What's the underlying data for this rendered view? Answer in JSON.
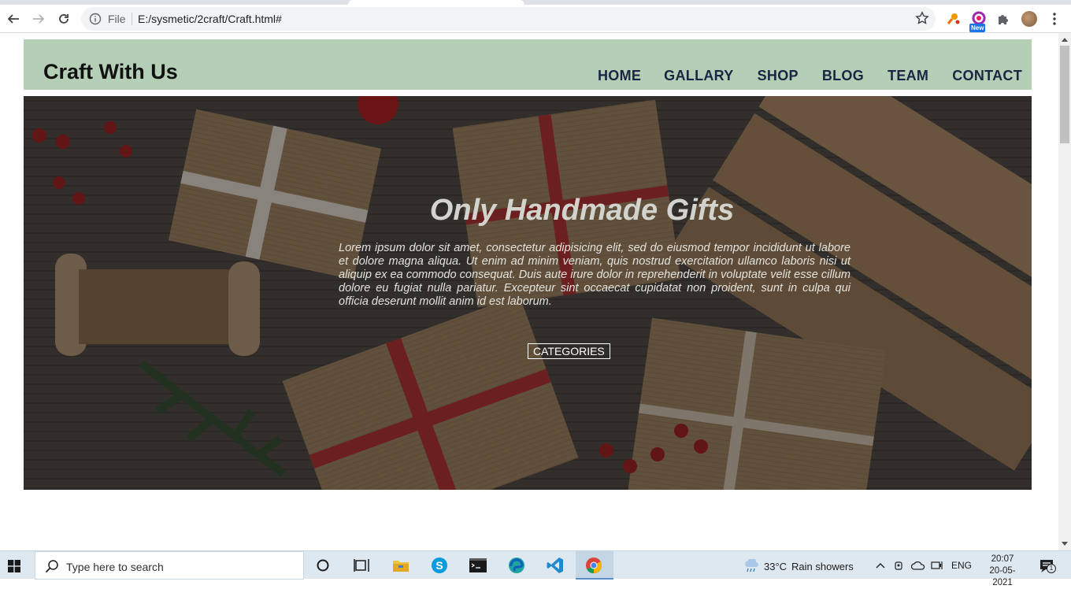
{
  "browser": {
    "omnibox": {
      "file_label": "File",
      "url": "E:/sysmetic/2craft/Craft.html#"
    },
    "extension_badge": "New"
  },
  "site": {
    "logo": "Craft With Us",
    "nav": [
      "HOME",
      "GALLARY",
      "SHOP",
      "BLOG",
      "TEAM",
      "CONTACT"
    ],
    "hero": {
      "title": "Only Handmade Gifts",
      "text": "Lorem ipsum dolor sit amet, consectetur adipisicing elit, sed do eiusmod tempor incididunt ut labore et dolore magna aliqua. Ut enim ad minim veniam, quis nostrud exercitation ullamco laboris nisi ut aliquip ex ea commodo consequat. Duis aute irure dolor in reprehenderit in voluptate velit esse cillum dolore eu fugiat nulla pariatur. Excepteur sint occaecat cupidatat non proident, sunt in culpa qui officia deserunt mollit anim id est laborum.",
      "button": "CATEGORIES"
    },
    "colors": {
      "header_bg": "#b5cfb6",
      "nav_text": "#1b2543"
    }
  },
  "taskbar": {
    "search_placeholder": "Type here to search",
    "weather": {
      "temp": "33°C",
      "condition": "Rain showers"
    },
    "language": "ENG",
    "time": "20:07",
    "date": "20-05-2021",
    "notification_count": "1"
  }
}
